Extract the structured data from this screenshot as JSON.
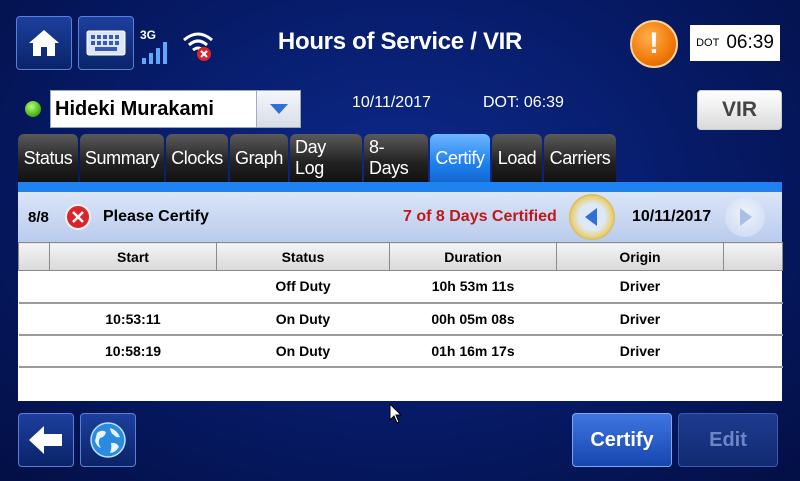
{
  "header": {
    "title": "Hours of Service / VIR",
    "signal_label": "3G",
    "dot_label": "DOT",
    "dot_time": "06:39"
  },
  "driver": {
    "name": "Hideki Murakami",
    "status_color": "#4fb81b"
  },
  "info": {
    "date": "10/11/2017",
    "dot_text": "DOT: 06:39",
    "vir_label": "VIR"
  },
  "tabs": [
    {
      "label": "Status",
      "active": false
    },
    {
      "label": "Summary",
      "active": false
    },
    {
      "label": "Clocks",
      "active": false
    },
    {
      "label": "Graph",
      "active": false
    },
    {
      "label": "Day Log",
      "active": false
    },
    {
      "label": "8-Days",
      "active": false
    },
    {
      "label": "Certify",
      "active": true
    },
    {
      "label": "Load",
      "active": false
    },
    {
      "label": "Carriers",
      "active": false
    }
  ],
  "certify": {
    "count": "8/8",
    "prompt": "Please Certify",
    "certified_text": "7 of 8 Days Certified",
    "date": "10/11/2017",
    "accent_color": "#c01818"
  },
  "table": {
    "columns": [
      "",
      "Start",
      "Status",
      "Duration",
      "Origin",
      ""
    ],
    "rows": [
      {
        "start": "",
        "status": "Off Duty",
        "duration": "10h 53m 11s",
        "origin": "Driver"
      },
      {
        "start": "10:53:11",
        "status": "On Duty",
        "duration": "00h 05m 08s",
        "origin": "Driver"
      },
      {
        "start": "10:58:19",
        "status": "On Duty",
        "duration": "01h 16m 17s",
        "origin": "Driver"
      }
    ]
  },
  "footer": {
    "certify_label": "Certify",
    "edit_label": "Edit"
  }
}
